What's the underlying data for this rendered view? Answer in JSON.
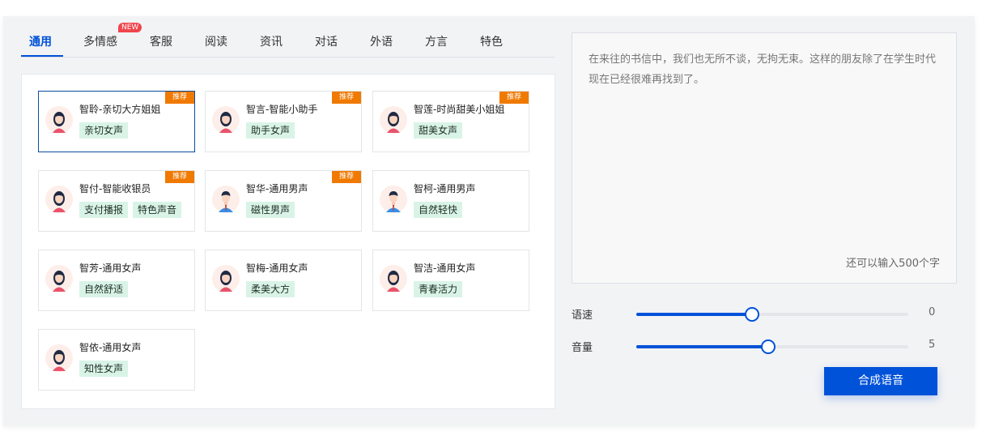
{
  "tabs": [
    {
      "label": "通用",
      "active": true
    },
    {
      "label": "多情感",
      "badge": "NEW"
    },
    {
      "label": "客服"
    },
    {
      "label": "阅读"
    },
    {
      "label": "资讯"
    },
    {
      "label": "对话"
    },
    {
      "label": "外语"
    },
    {
      "label": "方言"
    },
    {
      "label": "特色"
    }
  ],
  "voices": [
    {
      "name": "智聆-亲切大方姐姐",
      "tags": [
        "亲切女声"
      ],
      "badge": "推荐",
      "gender": "female",
      "selected": true
    },
    {
      "name": "智言-智能小助手",
      "tags": [
        "助手女声"
      ],
      "badge": "推荐",
      "gender": "female"
    },
    {
      "name": "智莲-时尚甜美小姐姐",
      "tags": [
        "甜美女声"
      ],
      "badge": "推荐",
      "gender": "female"
    },
    {
      "name": "智付-智能收银员",
      "tags": [
        "支付播报",
        "特色声音"
      ],
      "badge": "推荐",
      "gender": "female"
    },
    {
      "name": "智华-通用男声",
      "tags": [
        "磁性男声"
      ],
      "badge": "推荐",
      "gender": "male"
    },
    {
      "name": "智柯-通用男声",
      "tags": [
        "自然轻快"
      ],
      "gender": "male"
    },
    {
      "name": "智芳-通用女声",
      "tags": [
        "自然舒适"
      ],
      "gender": "female"
    },
    {
      "name": "智梅-通用女声",
      "tags": [
        "柔美大方"
      ],
      "gender": "female"
    },
    {
      "name": "智洁-通用女声",
      "tags": [
        "青春活力"
      ],
      "gender": "female"
    },
    {
      "name": "智依-通用女声",
      "tags": [
        "知性女声"
      ],
      "gender": "female"
    }
  ],
  "text_input": {
    "value": "在来往的书信中，我们也无所不谈，无拘无束。这样的朋友除了在学生时代现在已经很难再找到了。",
    "remaining": "还可以输入500个字"
  },
  "sliders": {
    "speed": {
      "label": "语速",
      "value": "0",
      "fraction": 0.425
    },
    "volume": {
      "label": "音量",
      "value": "5",
      "fraction": 0.485
    }
  },
  "synthesize_label": "合成语音",
  "colors": {
    "accent": "#0052d9",
    "badge_orange": "#f07900",
    "badge_new": "#f0454d",
    "tag_bg": "#d9f4e7"
  }
}
